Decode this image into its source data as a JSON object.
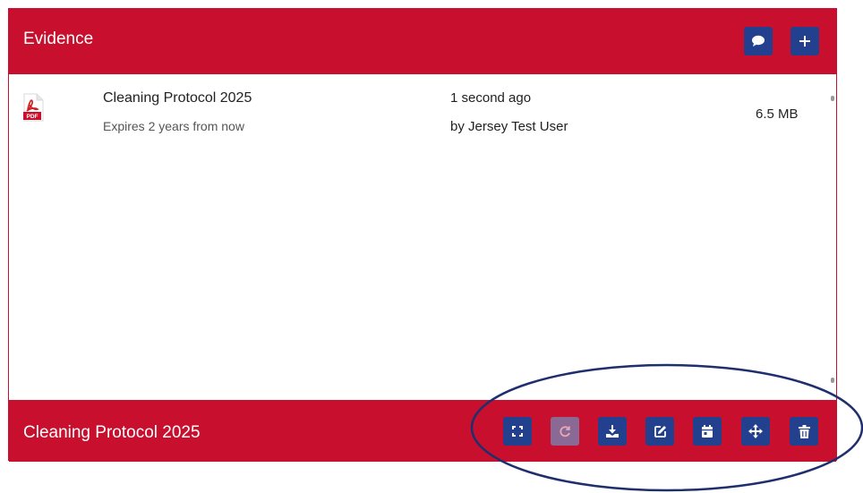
{
  "header": {
    "title": "Evidence",
    "comment_icon": "comment-icon",
    "add_icon": "plus-icon"
  },
  "document": {
    "file_type_label": "PDF",
    "title": "Cleaning Protocol 2025",
    "expiry": "Expires 2 years from now",
    "uploaded": "1 second ago",
    "uploaded_by": "by Jersey Test User",
    "size": "6.5 MB"
  },
  "footer": {
    "selected_title": "Cleaning Protocol 2025",
    "actions": [
      {
        "name": "expand-icon",
        "enabled": true
      },
      {
        "name": "refresh-icon",
        "enabled": false
      },
      {
        "name": "download-icon",
        "enabled": true
      },
      {
        "name": "edit-icon",
        "enabled": true
      },
      {
        "name": "calendar-icon",
        "enabled": true
      },
      {
        "name": "move-icon",
        "enabled": true
      },
      {
        "name": "trash-icon",
        "enabled": true
      }
    ]
  },
  "colors": {
    "header_bg": "#c8102e",
    "button_bg": "#23408e",
    "button_disabled_bg": "#8a6a94",
    "annotation_ellipse": "#1f2f6e"
  }
}
